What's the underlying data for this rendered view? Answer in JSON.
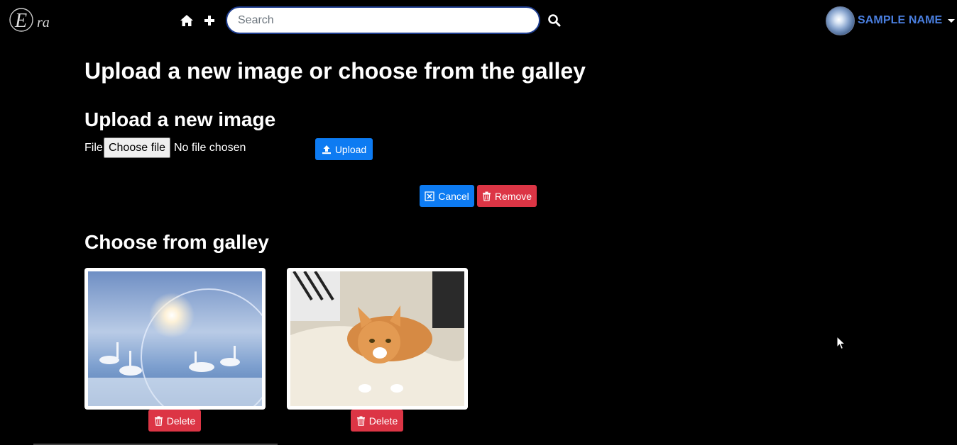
{
  "navbar": {
    "logo_text": "Era",
    "search": {
      "placeholder": "Search",
      "value": ""
    },
    "icons": [
      "home-icon",
      "plus-icon",
      "search-icon"
    ],
    "user": {
      "name": "SAMPLE NAME"
    }
  },
  "page": {
    "title": "Upload a new image or choose from the galley",
    "upload_section": {
      "title": "Upload a new image",
      "file_label": "File:",
      "choose_button": "Choose file",
      "file_status": "No file chosen",
      "upload_button": "Upload"
    },
    "actions": {
      "cancel_button": "Cancel",
      "remove_button": "Remove"
    },
    "gallery": {
      "title": "Choose from galley",
      "items": [
        {
          "description_icon": "swans-winter-image",
          "delete_label": "Delete"
        },
        {
          "description_icon": "kitten-image",
          "delete_label": "Delete"
        }
      ]
    }
  },
  "colors": {
    "background": "#000000",
    "primary": "#0d7bf2",
    "danger": "#dc3545",
    "user_name": "#4a7fe0"
  }
}
